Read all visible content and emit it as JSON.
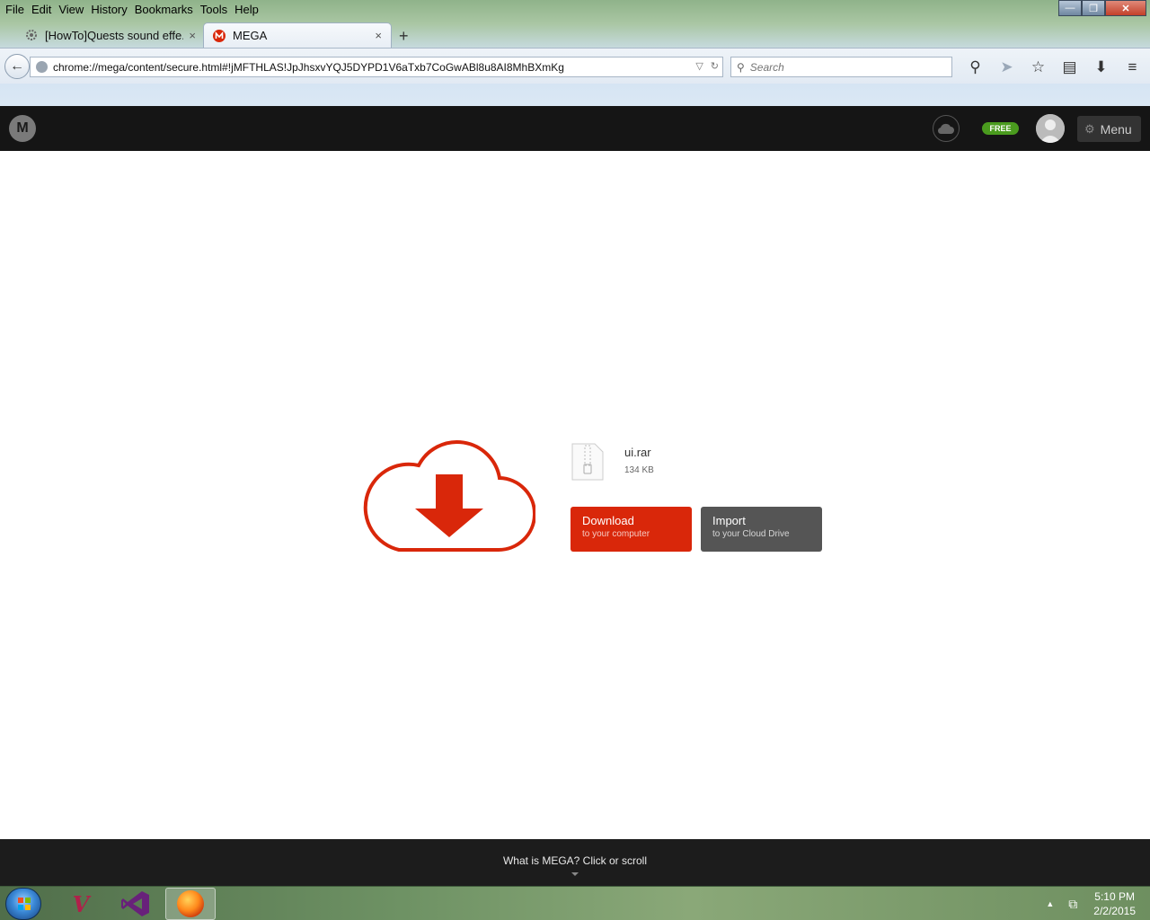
{
  "menubar": [
    "File",
    "Edit",
    "View",
    "History",
    "Bookmarks",
    "Tools",
    "Help"
  ],
  "window_buttons": {
    "minimize": "—",
    "maximize": "❐",
    "close": "✕"
  },
  "tabs": [
    {
      "title": "[HowTo]Quests sound effe...",
      "close": "×"
    },
    {
      "title": "MEGA",
      "close": "×"
    }
  ],
  "new_tab": "+",
  "navbar": {
    "url": "chrome://mega/content/secure.html#!jMFTHLAS!JpJhsxvYQJ5DYPD1V6aTxb7CoGwABl8u8AI8MhBXmKg",
    "search_placeholder": "Search"
  },
  "toolbar_icons": [
    "magnifier-icon",
    "send-icon",
    "star-icon",
    "clipboard-icon",
    "download-icon",
    "hamburger-icon"
  ],
  "mega_header": {
    "logo": "M",
    "plan_badge": "FREE",
    "menu_label": "Menu"
  },
  "file": {
    "name": "ui.rar",
    "size": "134 KB"
  },
  "buttons": {
    "download": {
      "title": "Download",
      "subtitle": "to your computer"
    },
    "import": {
      "title": "Import",
      "subtitle": "to your Cloud Drive"
    }
  },
  "footer": {
    "text": "What is MEGA? Click or scroll"
  },
  "taskbar": {
    "time": "5:10 PM",
    "date": "2/2/2015"
  },
  "colors": {
    "mega_red": "#d9270a",
    "header_black": "#151515",
    "free_green": "#4a9b1e",
    "import_gray": "#555555"
  }
}
